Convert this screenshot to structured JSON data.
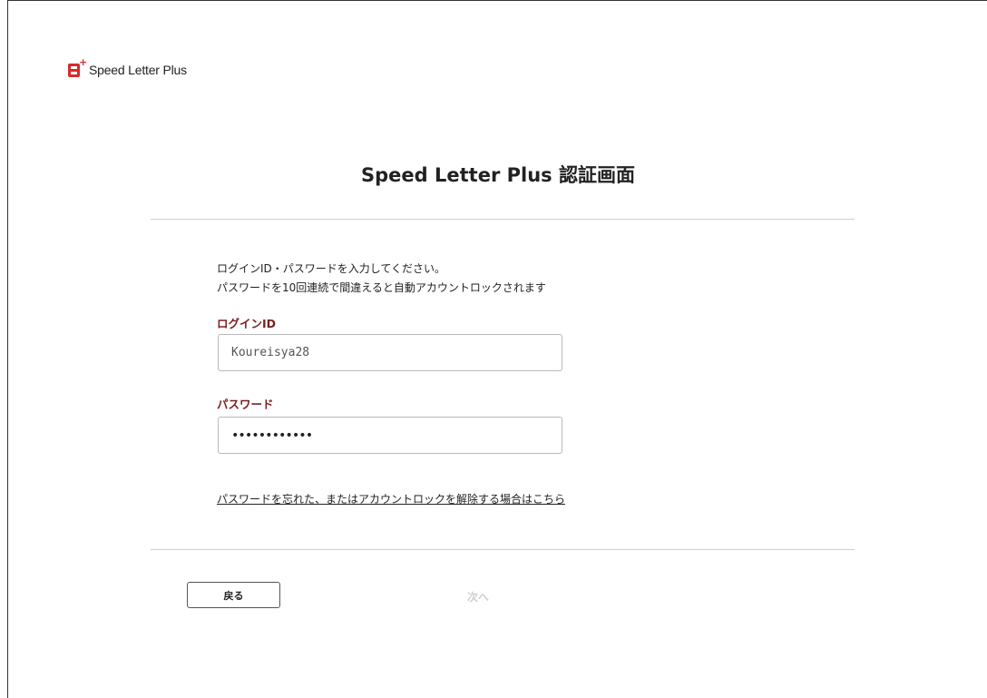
{
  "brand": {
    "logo_mark": "S",
    "logo_plus": "+",
    "name": "Speed Letter Plus",
    "accent_color": "#d62b2b"
  },
  "page": {
    "title": "Speed Letter Plus 認証画面"
  },
  "instructions": {
    "line1": "ログインID・パスワードを入力してください。",
    "line2": "パスワードを10回連続で間違えると自動アカウントロックされます"
  },
  "login_id": {
    "label": "ログインID",
    "value": "Koureisya28"
  },
  "password": {
    "label": "パスワード",
    "masked_value": "••••••••••••"
  },
  "links": {
    "forgot": "パスワードを忘れた、またはアカウントロックを解除する場合はこちら"
  },
  "buttons": {
    "back": "戻る",
    "next": "次へ"
  }
}
